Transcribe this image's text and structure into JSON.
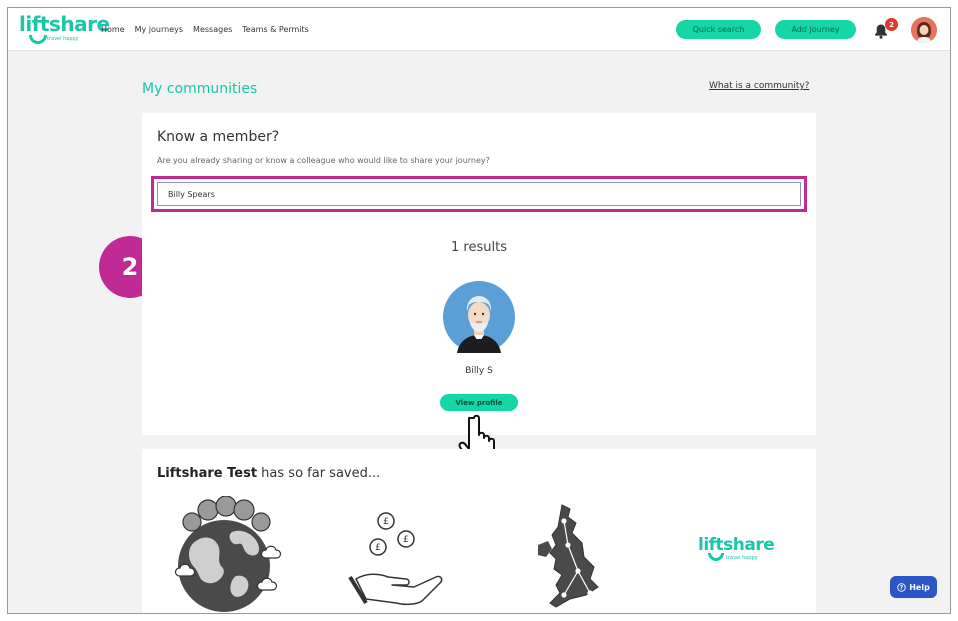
{
  "header": {
    "logo_text": "liftshare",
    "logo_tagline": "travel happy",
    "nav": [
      "Home",
      "My journeys",
      "Messages",
      "Teams & Permits"
    ],
    "quick_search_label": "Quick search",
    "add_journey_label": "Add journey",
    "notification_count": "2"
  },
  "page": {
    "title": "My communities",
    "what_link": "What is a community?"
  },
  "member_search": {
    "heading": "Know a member?",
    "subtext": "Are you already sharing or know a colleague who would like to share your journey?",
    "input_value": "Billy Spears",
    "results_text": "1 results",
    "result_name": "Billy S",
    "view_profile_label": "View profile"
  },
  "annotation": {
    "step_number": "2"
  },
  "savings": {
    "company": "Liftshare Test",
    "rest": " has so far saved...",
    "brand_logo_text": "liftshare",
    "brand_logo_tagline": "travel happy"
  },
  "help_label": "Help",
  "colors": {
    "brand_green": "#18c7a6",
    "button_green": "#14d6a6",
    "highlight_magenta": "#c02a94",
    "help_blue": "#2a56c6",
    "badge_red": "#e1362d"
  }
}
